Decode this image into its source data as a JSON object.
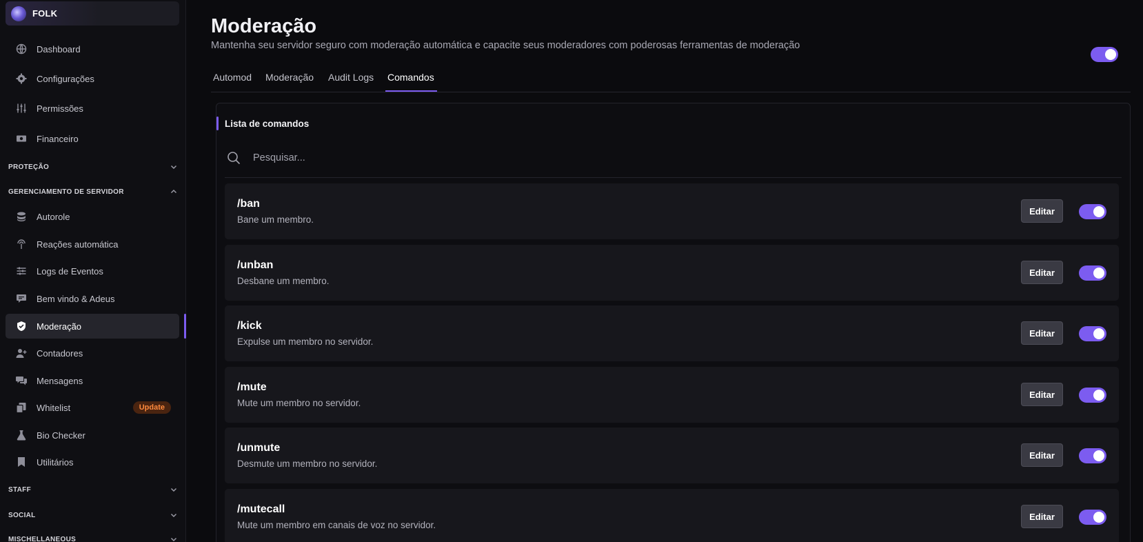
{
  "server": {
    "name": "FOLK"
  },
  "sidebar": {
    "top_items": [
      {
        "label": "Dashboard",
        "icon": "globe-icon"
      },
      {
        "label": "Configurações",
        "icon": "gear-icon"
      },
      {
        "label": "Permissões",
        "icon": "sliders-icon"
      },
      {
        "label": "Financeiro",
        "icon": "money-icon"
      }
    ],
    "sections": {
      "protecao": "PROTEÇÃO",
      "gerenciamento": "GERENCIAMENTO DE SERVIDOR",
      "staff": "STAFF",
      "social": "SOCIAL",
      "misc": "MISCHELLANEOUS"
    },
    "server_items": [
      {
        "label": "Autorole",
        "icon": "stack-icon"
      },
      {
        "label": "Reações automática",
        "icon": "touch-icon"
      },
      {
        "label": "Logs de Eventos",
        "icon": "filters-icon"
      },
      {
        "label": "Bem vindo & Adeus",
        "icon": "chat-icon"
      },
      {
        "label": "Moderação",
        "icon": "shield-icon"
      },
      {
        "label": "Contadores",
        "icon": "user-plus-icon"
      },
      {
        "label": "Mensagens",
        "icon": "messages-icon"
      },
      {
        "label": "Whitelist",
        "icon": "copy-icon",
        "badge": "Update"
      },
      {
        "label": "Bio Checker",
        "icon": "flask-icon"
      },
      {
        "label": "Utilitários",
        "icon": "bookmark-icon"
      }
    ]
  },
  "header": {
    "title": "Moderação",
    "subtitle": "Mantenha seu servidor seguro com moderação automática e capacite seus moderadores com poderosas ferramentas de moderação"
  },
  "tabs": [
    "Automod",
    "Moderação",
    "Audit Logs",
    "Comandos"
  ],
  "active_tab": "Comandos",
  "panel": {
    "title": "Lista de comandos",
    "search_placeholder": "Pesquisar..."
  },
  "edit_label": "Editar",
  "commands": [
    {
      "name": "/ban",
      "description": "Bane um membro.",
      "enabled": true
    },
    {
      "name": "/unban",
      "description": "Desbane um membro.",
      "enabled": true
    },
    {
      "name": "/kick",
      "description": "Expulse um membro no servidor.",
      "enabled": true
    },
    {
      "name": "/mute",
      "description": "Mute um membro no servidor.",
      "enabled": true
    },
    {
      "name": "/unmute",
      "description": "Desmute um membro no servidor.",
      "enabled": true
    },
    {
      "name": "/mutecall",
      "description": "Mute um membro em canais de voz no servidor.",
      "enabled": true
    }
  ],
  "colors": {
    "accent": "#7c5cf0",
    "badge_bg": "#4a2410",
    "badge_text": "#ff8a3d"
  }
}
